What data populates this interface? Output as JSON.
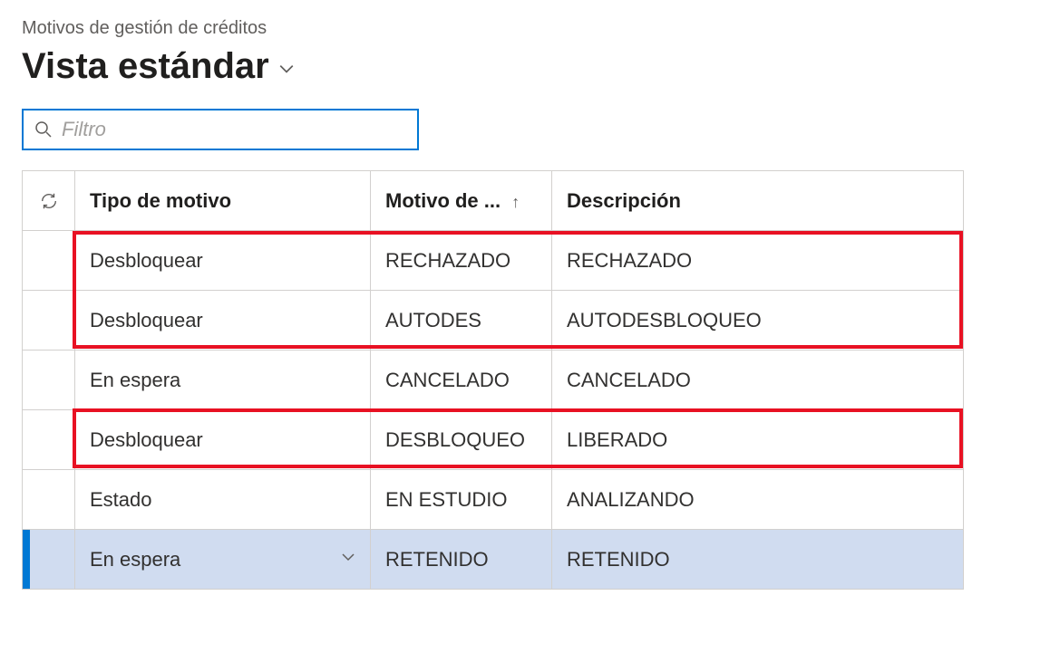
{
  "breadcrumb": "Motivos de gestión de créditos",
  "title": "Vista estándar",
  "filter": {
    "placeholder": "Filtro",
    "value": ""
  },
  "columns": {
    "tipo": "Tipo de motivo",
    "motivo": "Motivo de ...",
    "descripcion": "Descripción"
  },
  "rows": [
    {
      "tipo": "Desbloquear",
      "motivo": "RECHAZADO",
      "descripcion": "RECHAZADO",
      "selected": false,
      "highlighted": true
    },
    {
      "tipo": "Desbloquear",
      "motivo": "AUTODES",
      "descripcion": "AUTODESBLOQUEO",
      "selected": false,
      "highlighted": true
    },
    {
      "tipo": "En espera",
      "motivo": "CANCELADO",
      "descripcion": "CANCELADO",
      "selected": false,
      "highlighted": false
    },
    {
      "tipo": "Desbloquear",
      "motivo": "DESBLOQUEO",
      "descripcion": "LIBERADO",
      "selected": false,
      "highlighted": true
    },
    {
      "tipo": "Estado",
      "motivo": "EN ESTUDIO",
      "descripcion": "ANALIZANDO",
      "selected": false,
      "highlighted": false
    },
    {
      "tipo": "En espera",
      "motivo": "RETENIDO",
      "descripcion": "RETENIDO",
      "selected": true,
      "highlighted": false
    }
  ]
}
